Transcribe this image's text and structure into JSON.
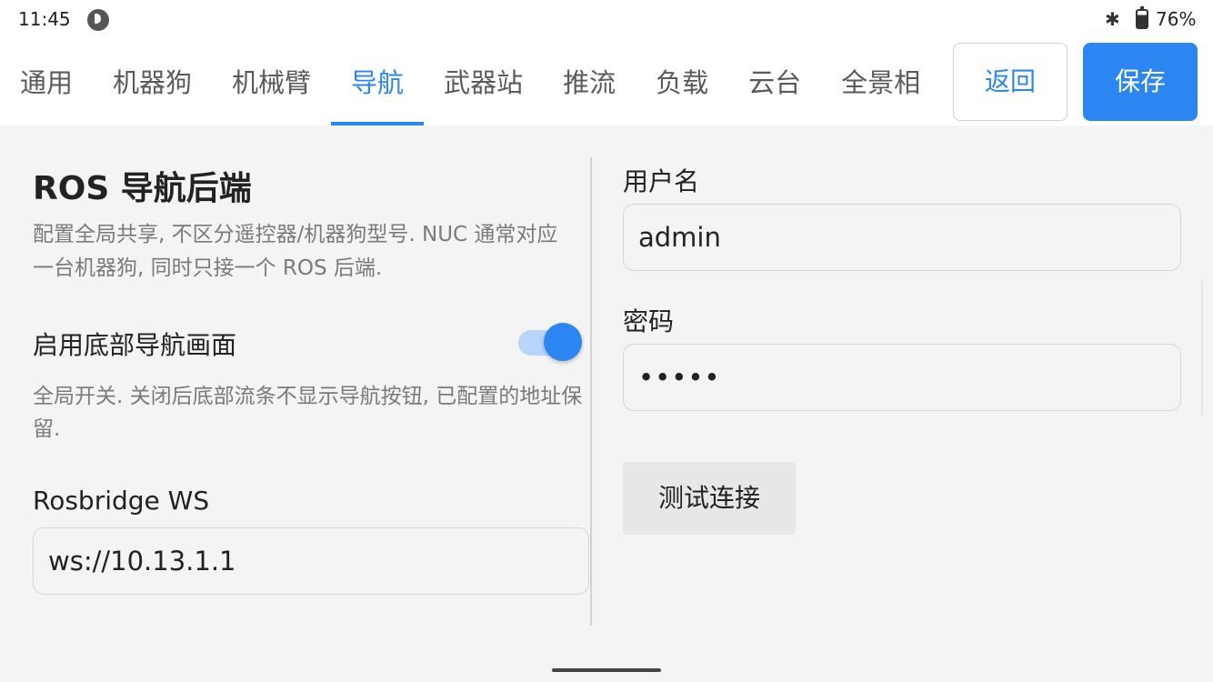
{
  "status_bar": {
    "time": "11:45",
    "app_icon": "app-notification-icon",
    "bluetooth_icon": "bluetooth-icon",
    "battery_icon": "battery-charging-icon",
    "battery_percent": "76%"
  },
  "tabs": [
    {
      "label": "通用",
      "active": false
    },
    {
      "label": "机器狗",
      "active": false
    },
    {
      "label": "机械臂",
      "active": false
    },
    {
      "label": "导航",
      "active": true
    },
    {
      "label": "武器站",
      "active": false
    },
    {
      "label": "推流",
      "active": false
    },
    {
      "label": "负载",
      "active": false
    },
    {
      "label": "云台",
      "active": false
    },
    {
      "label": "全景相",
      "active": false
    }
  ],
  "header_actions": {
    "back_label": "返回",
    "save_label": "保存"
  },
  "section": {
    "title": "ROS 导航后端",
    "description": "配置全局共享, 不区分遥控器/机器狗型号. NUC 通常对应一台机器狗, 同时只接一个 ROS 后端."
  },
  "toggle": {
    "label": "启用底部导航画面",
    "enabled": true,
    "description": "全局开关. 关闭后底部流条不显示导航按钮, 已配置的地址保留."
  },
  "rosbridge": {
    "label": "Rosbridge WS",
    "value": "ws://10.13.1.1"
  },
  "username": {
    "label": "用户名",
    "value": "admin"
  },
  "password": {
    "label": "密码",
    "value": "•••••"
  },
  "test_button": {
    "label": "测试连接"
  },
  "colors": {
    "accent": "#2b86f2",
    "toggle_track": "#b7d5fb",
    "background": "#f4f4f4"
  }
}
